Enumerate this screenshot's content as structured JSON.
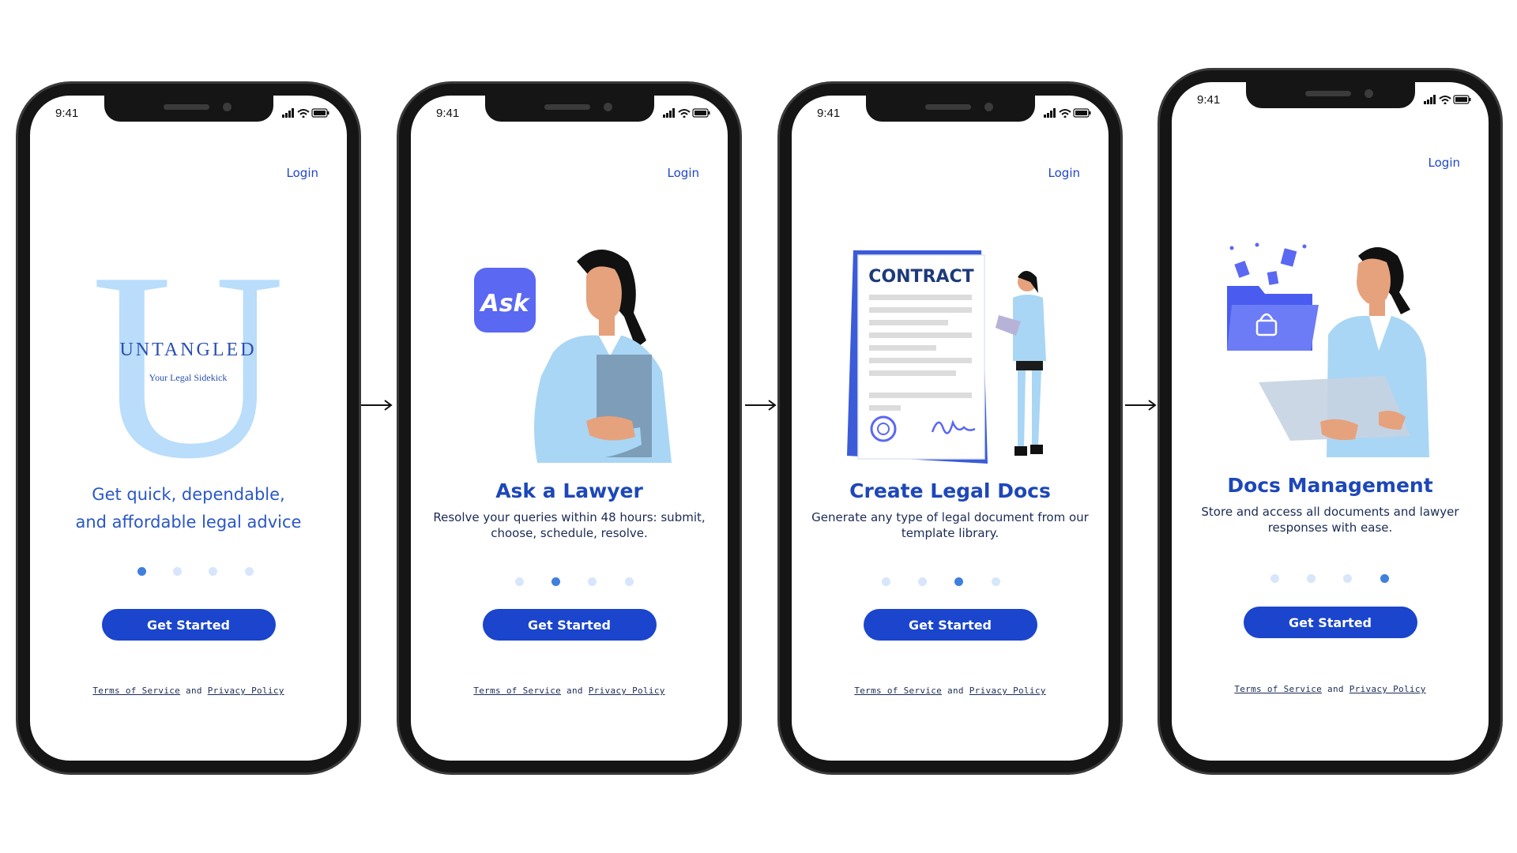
{
  "status_time": "9:41",
  "login_label": "Login",
  "cta_label": "Get Started",
  "legal": {
    "terms": "Terms of Service",
    "and": "and",
    "privacy": "Privacy Policy"
  },
  "colors": {
    "primary": "#1a45cc",
    "heading": "#1d47b9",
    "logo_light": "#b9ddfa",
    "dot_active": "#3f7fdd",
    "dot_inactive": "#d7e6fb"
  },
  "screens": [
    {
      "headline": "Get quick, dependable, and affordable legal advice",
      "logo_letter": "U",
      "logo_word": "UNTANGLED",
      "logo_tagline": "Your Legal Sidekick",
      "active_dot": 1,
      "illustration": "untangled-logo"
    },
    {
      "title": "Ask a Lawyer",
      "subtitle": "Resolve your queries within 48 hours: submit, choose, schedule, resolve.",
      "badge": "Ask",
      "active_dot": 2,
      "illustration": "woman-holding-folder"
    },
    {
      "title": "Create Legal Docs",
      "subtitle": "Generate any type of legal document from our template library.",
      "doc_heading": "CONTRACT",
      "active_dot": 3,
      "illustration": "contract-document"
    },
    {
      "title": "Docs Management",
      "subtitle": "Store and access all documents and lawyer responses with ease.",
      "active_dot": 4,
      "illustration": "folder-and-tablet"
    }
  ],
  "icons": [
    "signal-icon",
    "wifi-icon",
    "battery-icon",
    "arrow-right-icon"
  ]
}
